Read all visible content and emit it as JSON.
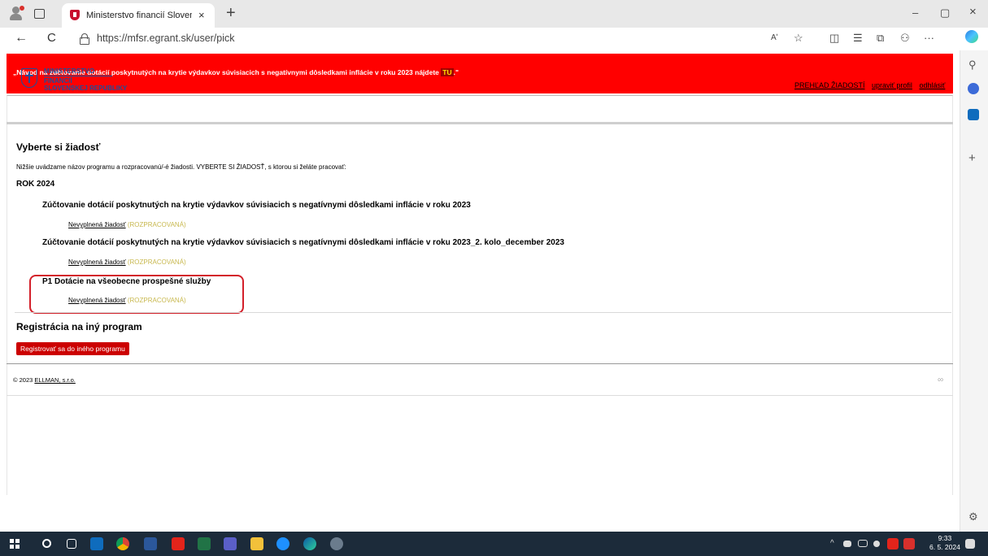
{
  "browser": {
    "tab_title": "Ministerstvo financií Slovenskej r",
    "tab_close": "×",
    "new_tab": "+",
    "url": "https://mfsr.egrant.sk/user/pick",
    "window_controls": {
      "minimize": "–",
      "restore": "▢",
      "close": "×"
    },
    "nav": {
      "back": "←",
      "reload": "C"
    },
    "tool_icons": [
      "read-aloud-icon",
      "favorite-icon",
      "split-screen-icon",
      "favorites-bar-icon",
      "collections-icon",
      "extensions-icon",
      "more-icon",
      "copilot-icon"
    ],
    "more_label": "···",
    "read_aloud_label": "Aʹ"
  },
  "announcement": {
    "text": "„Návod na zúčtovanie dotácií poskytnutých na krytie výdavkov súvisiacich s negatívnymi dôsledkami inflácie v roku 2023 nájdete ",
    "link": "TU",
    "end": ".\""
  },
  "logo": {
    "line1": "MINISTERSTVO",
    "line2": "FINANCIÍ",
    "line3": "SLOVENSKEJ REPUBLIKY"
  },
  "top_links": {
    "overview": "PREHĽAD ŽIADOSTÍ",
    "profile": "upraviť profil",
    "logout": "odhlásiť"
  },
  "main": {
    "heading": "Vyberte si žiadosť",
    "intro": "Nižšie uvádzame názov programu a rozpracovanú/-é žiadosti. VYBERTE SI ŽIADOSŤ, s ktorou si želáte pracovať:",
    "year": "ROK 2024",
    "programs": [
      {
        "name": "Zúčtovanie dotácií poskytnutých na krytie výdavkov súvisiacich s negatívnymi dôsledkami inflácie v roku 2023",
        "app_link": "Nevyplnená žiadosť",
        "status": "(ROZPRACOVANÁ)"
      },
      {
        "name": "Zúčtovanie dotácií poskytnutých na krytie výdavkov súvisiacich s negatívnymi dôsledkami inflácie v roku 2023_2. kolo_december 2023",
        "app_link": "Nevyplnená žiadosť",
        "status": "(ROZPRACOVANÁ)"
      },
      {
        "name": "P1 Dotácie na všeobecne prospešné služby",
        "app_link": "Nevyplnená žiadosť",
        "status": "(ROZPRACOVANÁ)"
      }
    ],
    "reg_heading": "Registrácia na iný program",
    "reg_button": "Registrovať sa do iného programu"
  },
  "footer": {
    "copyright": "© 2023 ",
    "company": "ELLMAN, s.r.o.",
    "chain_icon": "∞"
  },
  "taskbar": {
    "time": "9:33",
    "date": "6. 5. 2024",
    "tray_arrow": "^",
    "app_icons": [
      "windows-start-icon",
      "search-icon",
      "task-view-icon",
      "outlook-icon",
      "chrome-icon",
      "word-icon",
      "acrobat-icon",
      "excel-icon",
      "teams-icon",
      "explorer-icon",
      "ie-icon",
      "edge-icon",
      "app-icon"
    ]
  },
  "colors": {
    "banner": "#ff0000",
    "status": "#c8b84e",
    "highlight": "#d3202a",
    "button": "#cc0000",
    "logo": "#1b4f9c"
  }
}
